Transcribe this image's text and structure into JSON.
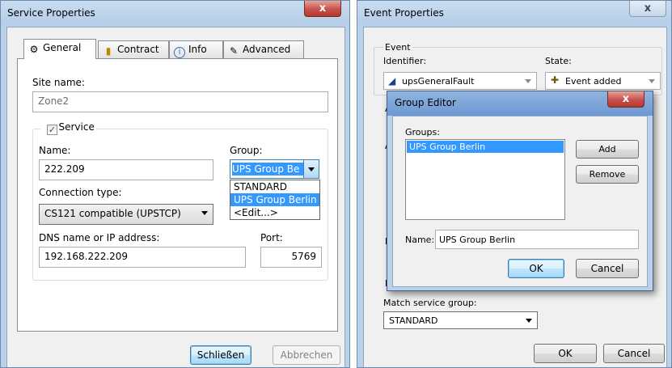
{
  "service_props": {
    "title": "Service Properties",
    "close": "x",
    "tabs": [
      {
        "label": "General",
        "icon": "gears-icon"
      },
      {
        "label": "Contract",
        "icon": "database-icon"
      },
      {
        "label": "Info",
        "icon": "info-icon"
      },
      {
        "label": "Advanced",
        "icon": "wrench-icon"
      }
    ],
    "site_name_label": "Site name:",
    "site_name_value": "Zone2",
    "service_group_label": "Service",
    "service_checked": true,
    "name_label": "Name:",
    "name_value": "222.209",
    "group_label": "Group:",
    "group_value": "UPS Group Be",
    "group_options": [
      "STANDARD",
      "UPS Group Berlin",
      "<Edit...>"
    ],
    "group_selected_index": 1,
    "connection_type_label": "Connection type:",
    "connection_type_value": "CS121 compatible (UPSTCP)",
    "dns_label": "DNS name or IP address:",
    "dns_value": "192.168.222.209",
    "port_label": "Port:",
    "port_value": "5769",
    "close_button": "Schließen",
    "cancel_button": "Abbrechen"
  },
  "event_props": {
    "title": "Event Properties",
    "close": "x",
    "event_group_label": "Event",
    "identifier_label": "Identifier:",
    "identifier_value": "upsGeneralFault",
    "state_label": "State:",
    "state_value": "Event added",
    "match_service_group_label": "Match service group:",
    "match_service_group_value": "STANDARD",
    "ok_button": "OK",
    "cancel_button": "Cancel",
    "partial_labels": [
      "A",
      "A",
      "D",
      "L",
      "R",
      "F"
    ]
  },
  "group_editor": {
    "title": "Group Editor",
    "close": "x",
    "groups_label": "Groups:",
    "groups": [
      "UPS Group Berlin"
    ],
    "selected_index": 0,
    "add_button": "Add",
    "remove_button": "Remove",
    "name_label": "Name:",
    "name_value": "UPS Group Berlin",
    "ok_button": "OK",
    "cancel_button": "Cancel"
  },
  "colors": {
    "selection": "#3399ff",
    "close_button": "#c75050"
  }
}
